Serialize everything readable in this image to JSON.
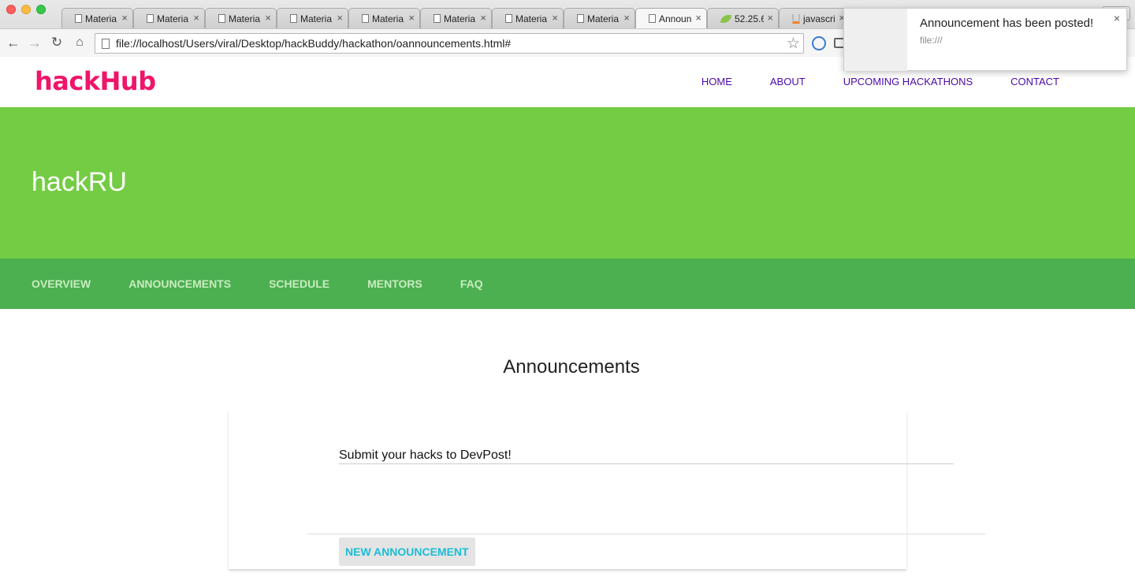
{
  "browser": {
    "tabs": [
      {
        "label": "Materia",
        "icon": "page-icon",
        "active": false
      },
      {
        "label": "Materia",
        "icon": "page-icon",
        "active": false
      },
      {
        "label": "Materia",
        "icon": "page-icon",
        "active": false
      },
      {
        "label": "Materia",
        "icon": "page-icon",
        "active": false
      },
      {
        "label": "Materia",
        "icon": "page-icon",
        "active": false
      },
      {
        "label": "Materia",
        "icon": "page-icon",
        "active": false
      },
      {
        "label": "Materia",
        "icon": "page-icon",
        "active": false
      },
      {
        "label": "Materia",
        "icon": "page-icon",
        "active": false
      },
      {
        "label": "Announ",
        "icon": "page-icon",
        "active": true
      },
      {
        "label": "52.25.6",
        "icon": "leaf-icon",
        "active": false
      },
      {
        "label": "javascri",
        "icon": "stackoverflow-icon",
        "active": false
      }
    ],
    "close_glyph": "×",
    "url": "file://localhost/Users/viral/Desktop/hackBuddy/hackathon/oannouncements.html#"
  },
  "notification": {
    "title": "Announcement has been posted!",
    "source": "file:///",
    "close": "×"
  },
  "site": {
    "logo": "hackHub",
    "nav": [
      "HOME",
      "ABOUT",
      "UPCOMING HACKATHONS",
      "CONTACT"
    ]
  },
  "hero": {
    "title": "hackRU"
  },
  "subnav": [
    "OVERVIEW",
    "ANNOUNCEMENTS",
    "SCHEDULE",
    "MENTORS",
    "FAQ"
  ],
  "content": {
    "section_title": "Announcements",
    "announcement_value": "Submit your hacks to DevPost!",
    "new_button": "NEW ANNOUNCEMENT"
  },
  "colors": {
    "logo": "#f0146a",
    "nav": "#4a0aa8",
    "hero": "#74cc44",
    "subnav": "#4caf50",
    "button_text": "#1bbcd4"
  }
}
